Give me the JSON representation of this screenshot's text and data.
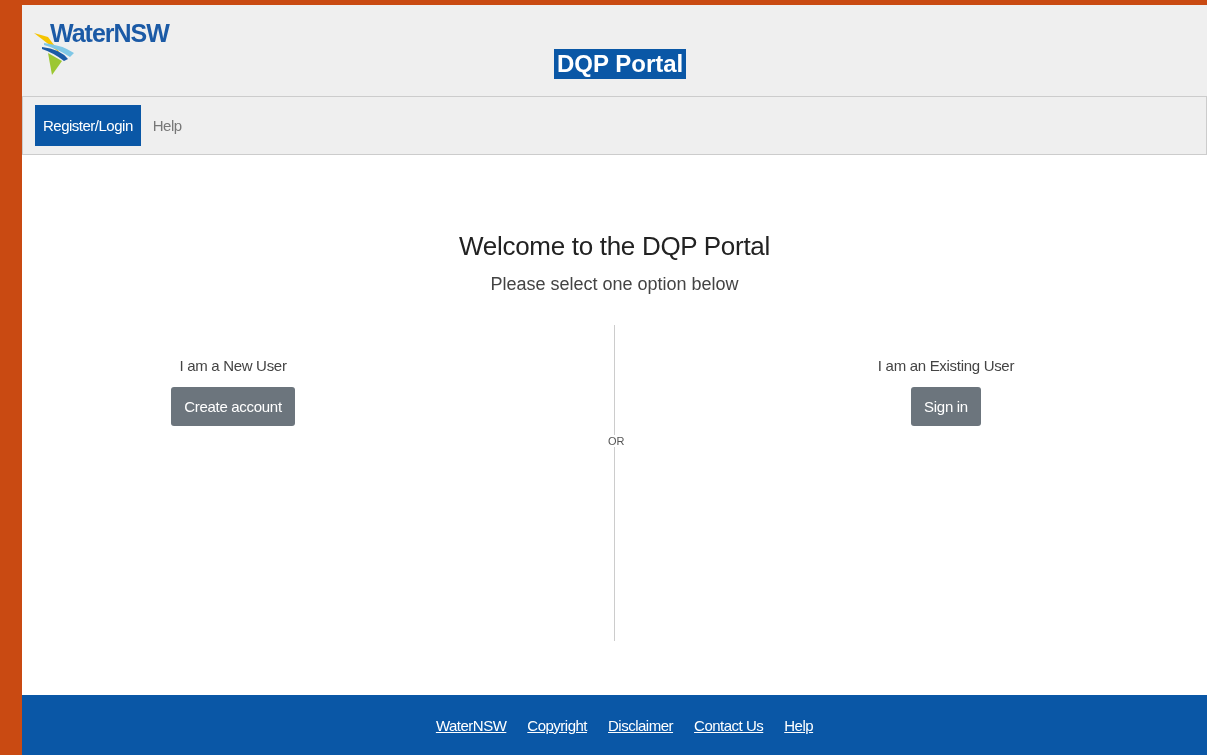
{
  "header": {
    "logo_text": "WaterNSW",
    "title": "DQP Portal"
  },
  "nav": [
    {
      "label": "Register/Login",
      "selected": true
    },
    {
      "label": "Help",
      "selected": false
    }
  ],
  "welcome": {
    "title": "Welcome to the DQP Portal",
    "subtitle": "Please select one option below",
    "divider_text": "OR",
    "options": [
      {
        "label": "I am a New User",
        "button": "Create account"
      },
      {
        "label": "I am an Existing User",
        "button": "Sign in"
      }
    ]
  },
  "footer_links": [
    "WaterNSW",
    "Copyright",
    "Disclaimer",
    "Contact Us",
    "Help"
  ]
}
